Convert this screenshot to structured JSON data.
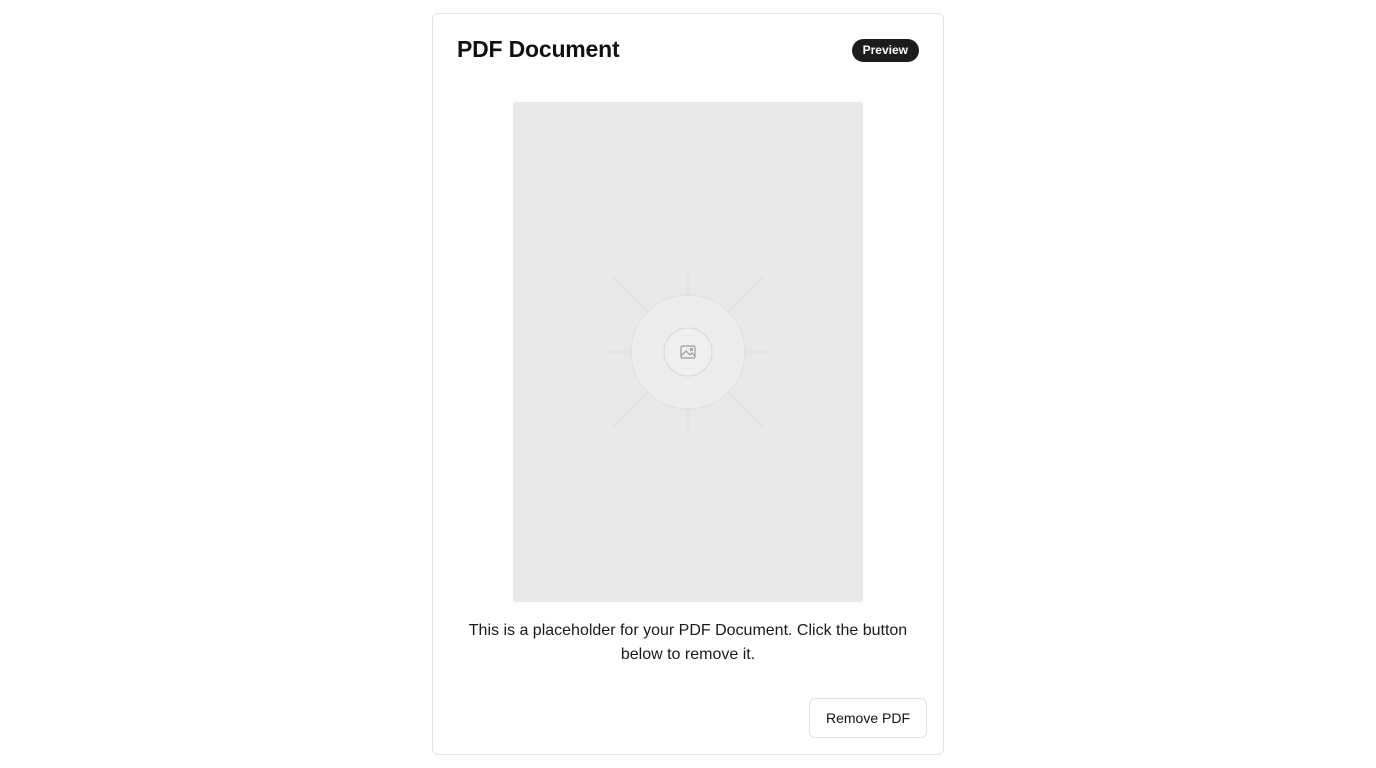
{
  "card": {
    "title": "PDF Document",
    "badge": "Preview",
    "description": "This is a placeholder for your PDF Document. Click the button below to remove it.",
    "remove_button_label": "Remove PDF"
  },
  "preview": {
    "icon": "image-icon"
  },
  "colors": {
    "badge_bg": "#1c1c1c",
    "preview_bg": "#e8e8e8",
    "border": "#e3e3e3"
  }
}
